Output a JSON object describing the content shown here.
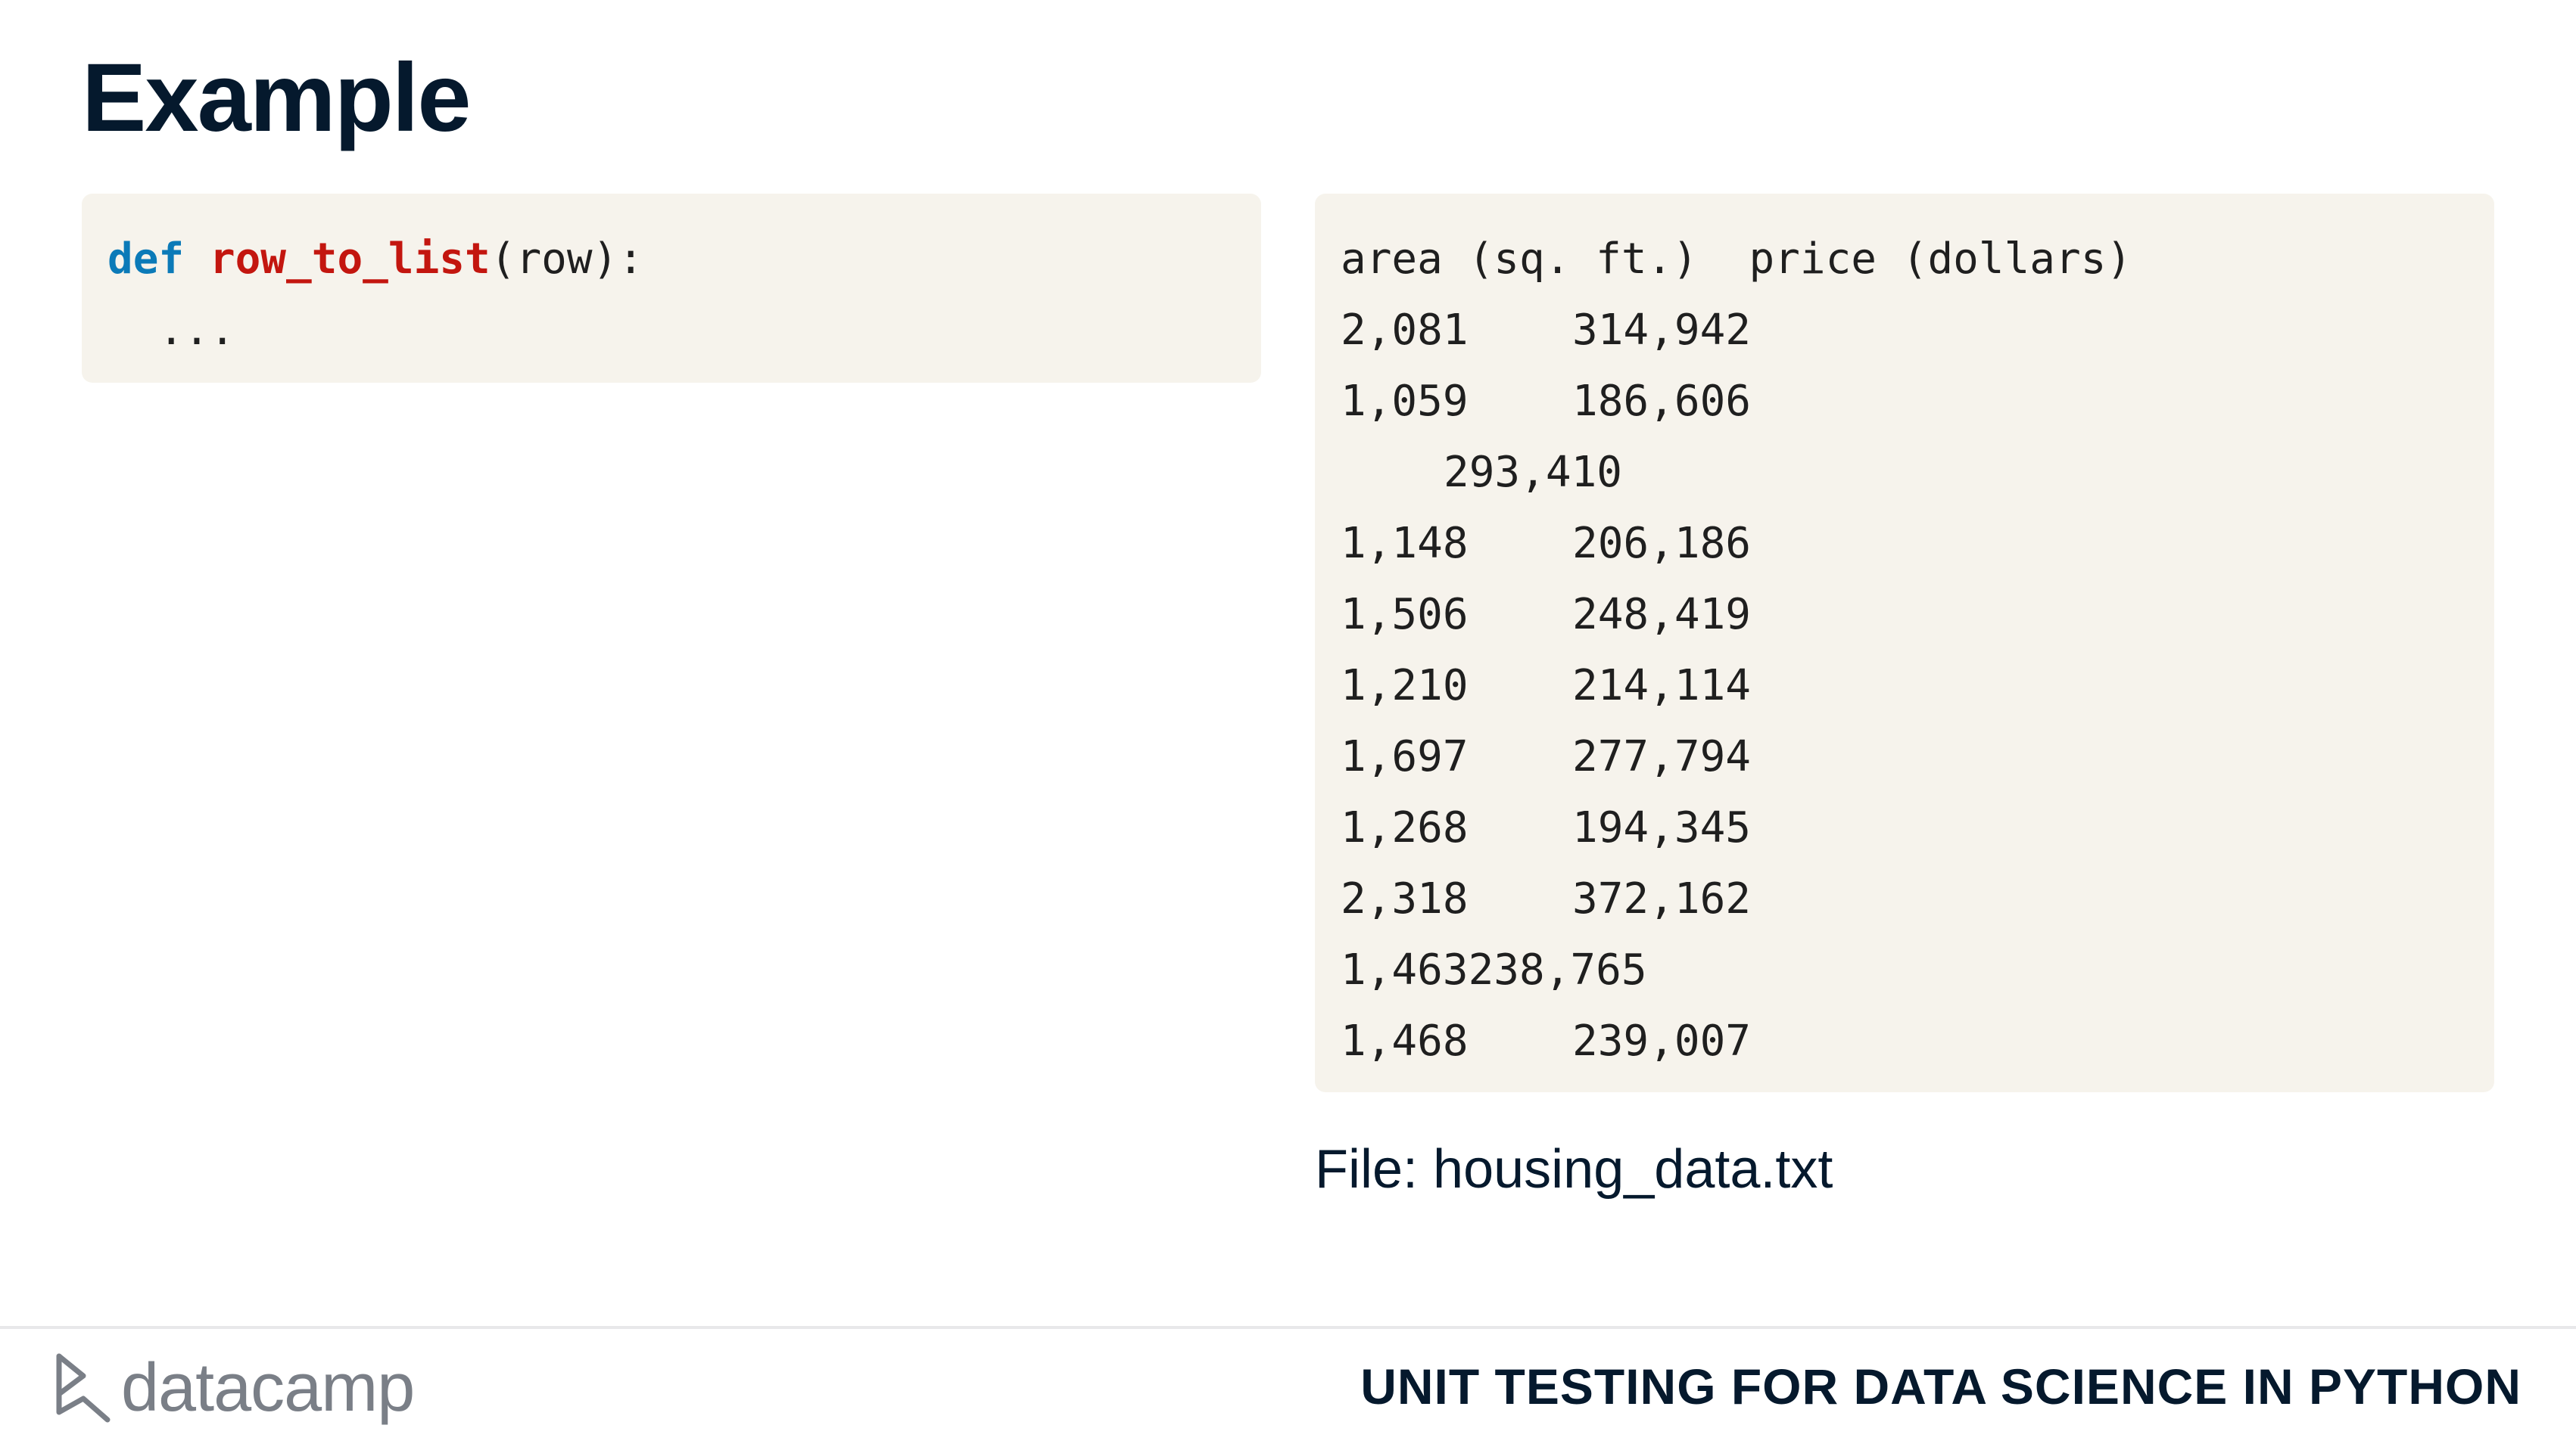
{
  "slide": {
    "title": "Example",
    "file_label": "File: housing_data.txt"
  },
  "code": {
    "def_keyword": "def",
    "function_name": "row_to_list",
    "signature_rest": "(row):",
    "body_line": "  ..."
  },
  "data_file": {
    "header": "area (sq. ft.)  price (dollars)",
    "rows": [
      {
        "area": "2,081",
        "price": "314,942"
      },
      {
        "area": "1,059",
        "price": "186,606"
      },
      {
        "area": "",
        "price": "293,410"
      },
      {
        "area": "1,148",
        "price": "206,186"
      },
      {
        "area": "1,506",
        "price": "248,419"
      },
      {
        "area": "1,210",
        "price": "214,114"
      },
      {
        "area": "1,697",
        "price": "277,794"
      },
      {
        "area": "1,268",
        "price": "194,345"
      },
      {
        "area": "2,318",
        "price": "372,162"
      },
      {
        "raw": "1,463238,765"
      },
      {
        "area": "1,468",
        "price": "239,007"
      }
    ]
  },
  "footer": {
    "brand": "datacamp",
    "course_title": "UNIT TESTING FOR DATA SCIENCE IN PYTHON"
  },
  "colors": {
    "keyword": "#0b7ab8",
    "function": "#c3160f",
    "code_bg": "#f6f3ec",
    "text": "#05192d",
    "logo": "#7a7f87"
  }
}
